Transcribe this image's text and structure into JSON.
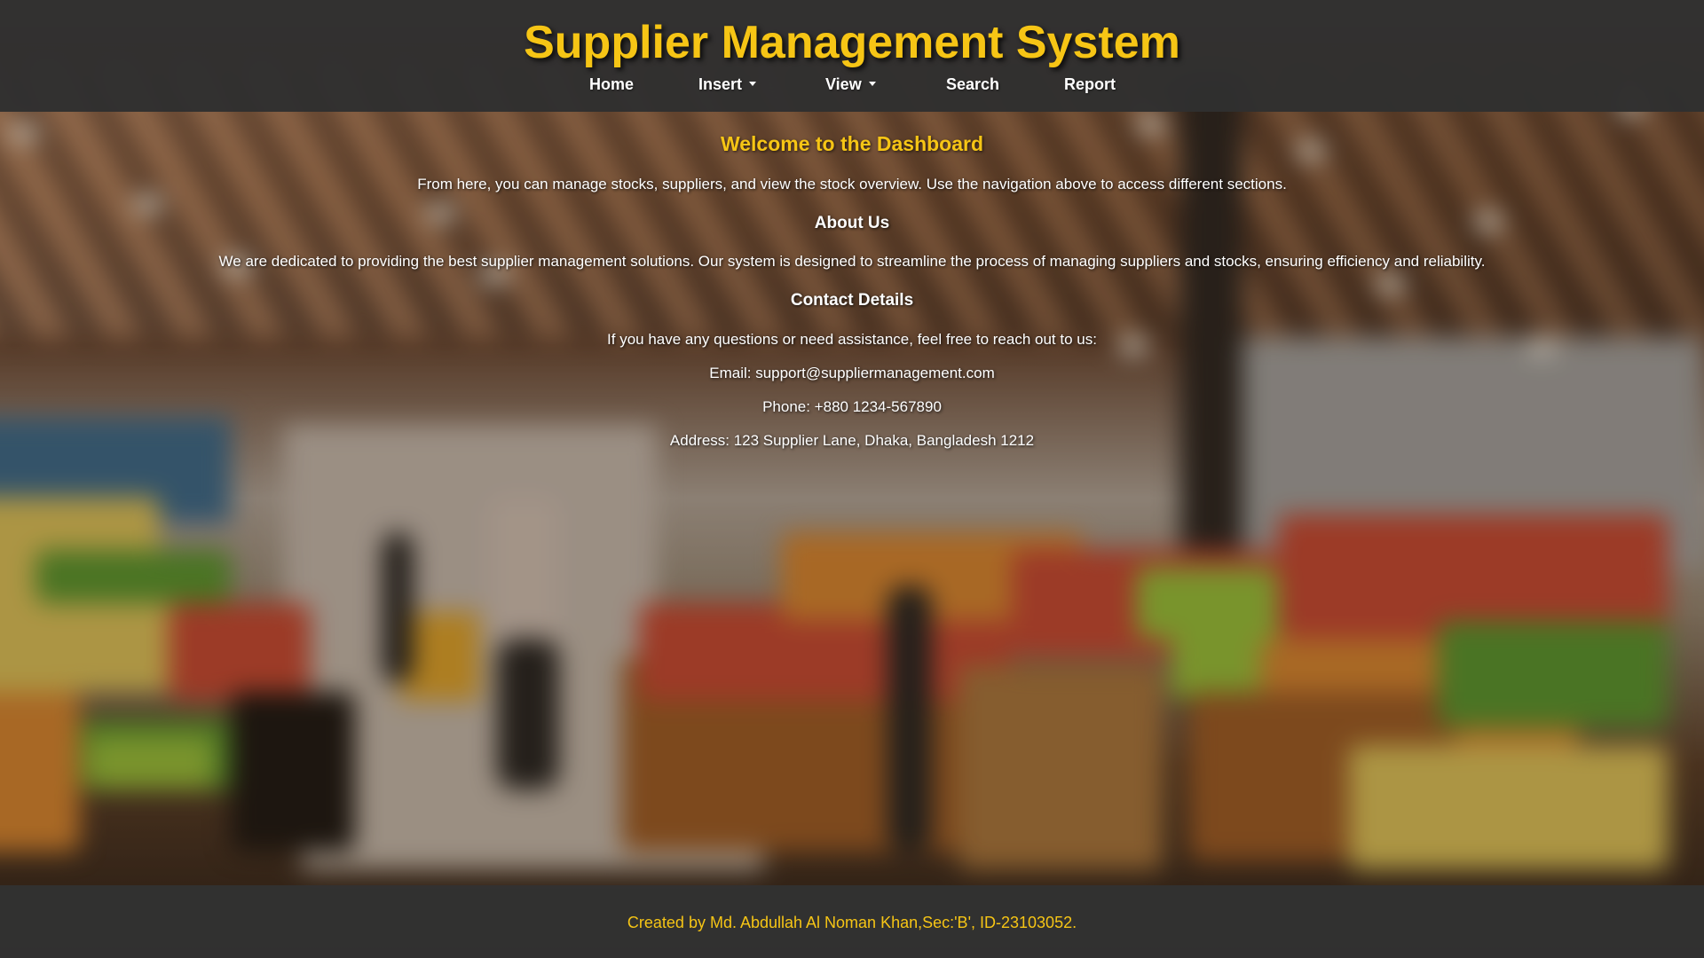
{
  "header": {
    "title": "Supplier Management System",
    "nav": [
      {
        "label": "Home",
        "has_dropdown": false
      },
      {
        "label": "Insert",
        "has_dropdown": true
      },
      {
        "label": "View",
        "has_dropdown": true
      },
      {
        "label": "Search",
        "has_dropdown": false
      },
      {
        "label": "Report",
        "has_dropdown": false
      }
    ]
  },
  "main": {
    "welcome_title": "Welcome to the Dashboard",
    "welcome_text": "From here, you can manage stocks, suppliers, and view the stock overview. Use the navigation above to access different sections.",
    "about_title": "About Us",
    "about_text": "We are dedicated to providing the best supplier management solutions. Our system is designed to streamline the process of managing suppliers and stocks, ensuring efficiency and reliability.",
    "contact_title": "Contact Details",
    "contact_intro": "If you have any questions or need assistance, feel free to reach out to us:",
    "email": "Email: support@suppliermanagement.com",
    "phone": "Phone: +880 1234-567890",
    "address": "Address: 123 Supplier Lane, Dhaka, Bangladesh 1212"
  },
  "footer": {
    "credit": "Created by Md. Abdullah Al Noman Khan,Sec:'B', ID-23103052."
  },
  "colors": {
    "accent": "#f6c515",
    "header_bg": "#303030",
    "text": "#ffffff"
  },
  "icons": [
    "caret-down-icon"
  ]
}
